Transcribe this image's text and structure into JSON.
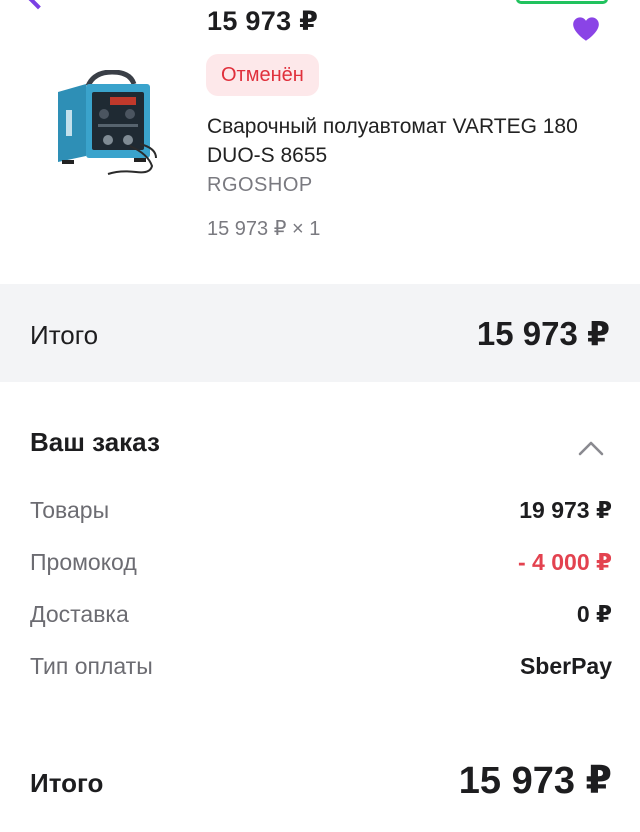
{
  "product": {
    "price": "15 973 ₽",
    "status": "Отменён",
    "title": "Сварочный полуавтомат VARTEG 180 DUO-S 8655",
    "seller": "RGOSHOP",
    "unit_price": "15 973 ₽ × 1"
  },
  "total_strip": {
    "label": "Итого",
    "value": "15 973 ₽"
  },
  "order": {
    "title": "Ваш заказ",
    "rows": [
      {
        "label": "Товары",
        "value": "19 973 ₽"
      },
      {
        "label": "Промокод",
        "value": "- 4 000 ₽"
      },
      {
        "label": "Доставка",
        "value": "0 ₽"
      },
      {
        "label": "Тип оплаты",
        "value": "SberPay"
      }
    ],
    "total_label": "Итого",
    "total_value": "15 973 ₽"
  },
  "colors": {
    "accent_purple": "#7b3fe4",
    "status_red": "#e0303c",
    "promo_red": "#e3424f",
    "strip_bg": "#f3f4f6"
  },
  "icons": [
    "back-chevron-icon",
    "heart-icon",
    "chevron-up-icon"
  ]
}
